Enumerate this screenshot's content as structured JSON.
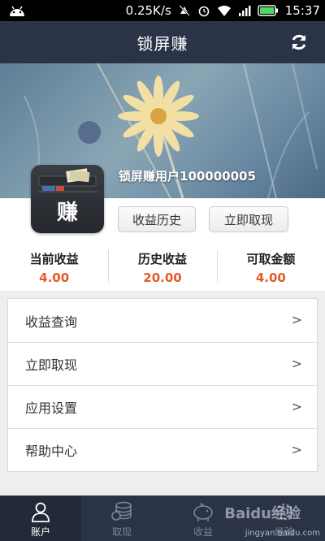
{
  "status_bar": {
    "speed": "0.25K/s",
    "time": "15:37",
    "icons": [
      "android-icon",
      "mute-icon",
      "alarm-icon",
      "wifi-icon",
      "signal-icon",
      "battery-icon"
    ]
  },
  "header": {
    "title": "锁屏赚",
    "refresh_icon": "refresh-icon"
  },
  "profile": {
    "logo_char": "赚",
    "username": "锁屏赚用户100000005",
    "history_button": "收益历史",
    "withdraw_button": "立即取现"
  },
  "stats": [
    {
      "label": "当前收益",
      "value": "4.00"
    },
    {
      "label": "历史收益",
      "value": "20.00"
    },
    {
      "label": "可取金额",
      "value": "4.00"
    }
  ],
  "menu": [
    {
      "label": "收益查询",
      "arrow": ">"
    },
    {
      "label": "立即取现",
      "arrow": ">"
    },
    {
      "label": "应用设置",
      "arrow": ">"
    },
    {
      "label": "帮助中心",
      "arrow": ">"
    }
  ],
  "tabs": [
    {
      "label": "账户",
      "icon": "user-icon",
      "active": true
    },
    {
      "label": "取现",
      "icon": "coins-icon",
      "active": false
    },
    {
      "label": "收益",
      "icon": "piggy-bank-icon",
      "active": false
    },
    {
      "label": "经验",
      "icon": "gear-icon",
      "active": false
    }
  ],
  "colors": {
    "header_bg": "#2b3447",
    "accent_value": "#e55a28"
  },
  "watermark": {
    "logo": "Baidu经验",
    "url": "jingyan.baidu.com"
  }
}
